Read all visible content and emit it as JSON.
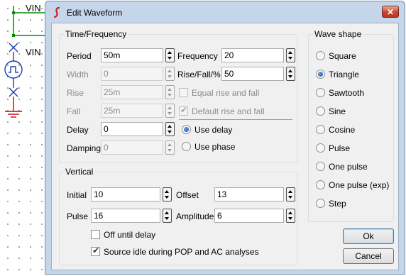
{
  "schematic": {
    "net_top": "VIN",
    "net_mid": "VIN"
  },
  "window": {
    "title": "Edit Waveform",
    "close_glyph": "✕"
  },
  "time_frequency": {
    "title": "Time/Frequency",
    "period": {
      "label": "Period",
      "value": "50m"
    },
    "width": {
      "label": "Width",
      "value": "0"
    },
    "rise": {
      "label": "Rise",
      "value": "25m"
    },
    "fall": {
      "label": "Fall",
      "value": "25m"
    },
    "delay": {
      "label": "Delay",
      "value": "0"
    },
    "damping": {
      "label": "Damping",
      "value": "0"
    },
    "frequency": {
      "label": "Frequency",
      "value": "20"
    },
    "rise_fall": {
      "label": "Rise/Fall/%",
      "value": "50"
    },
    "equal_rise_fall": {
      "label": "Equal rise and fall",
      "checked": false
    },
    "default_rise_fall": {
      "label": "Default rise and fall",
      "checked": true
    },
    "use_delay": {
      "label": "Use delay",
      "selected": true
    },
    "use_phase": {
      "label": "Use phase",
      "selected": false
    }
  },
  "vertical": {
    "title": "Vertical",
    "initial": {
      "label": "Initial",
      "value": "10"
    },
    "pulse": {
      "label": "Pulse",
      "value": "16"
    },
    "offset": {
      "label": "Offset",
      "value": "13"
    },
    "amplitude": {
      "label": "Amplitude",
      "value": "6"
    },
    "off_until_delay": {
      "label": "Off until delay",
      "checked": false
    },
    "source_idle": {
      "label": "Source idle during POP and AC analyses",
      "checked": true
    }
  },
  "wave_shape": {
    "title": "Wave shape",
    "options": [
      "Square",
      "Triangle",
      "Sawtooth",
      "Sine",
      "Cosine",
      "Pulse",
      "One pulse",
      "One pulse (exp)",
      "Step"
    ],
    "selected": "Triangle"
  },
  "buttons": {
    "ok": "Ok",
    "cancel": "Cancel"
  },
  "colors": {
    "accent": "#1b4ea3",
    "title_bar": "#c5d6ea",
    "close": "#c8452e",
    "wire": "#008a00"
  }
}
